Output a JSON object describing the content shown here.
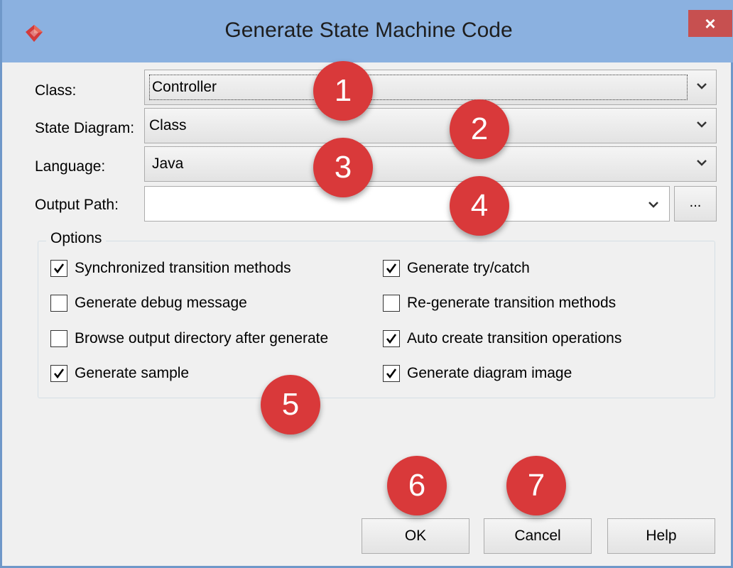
{
  "window": {
    "title": "Generate State Machine Code",
    "close_label": "×"
  },
  "form": {
    "class_label": "Class:",
    "class_value": "Controller",
    "state_diagram_label": "State Diagram:",
    "state_diagram_value": "Class",
    "language_label": "Language:",
    "language_value": "Java",
    "output_path_label": "Output Path:",
    "output_path_value": "",
    "browse_label": "..."
  },
  "options": {
    "title": "Options",
    "items": [
      {
        "label": "Synchronized transition methods",
        "checked": true
      },
      {
        "label": "Generate debug message",
        "checked": false
      },
      {
        "label": "Browse output directory after generate",
        "checked": false
      },
      {
        "label": "Generate sample",
        "checked": true
      },
      {
        "label": "Generate try/catch",
        "checked": true
      },
      {
        "label": "Re-generate transition methods",
        "checked": false
      },
      {
        "label": "Auto create transition operations",
        "checked": true
      },
      {
        "label": "Generate diagram image",
        "checked": true
      }
    ]
  },
  "buttons": {
    "ok": "OK",
    "cancel": "Cancel",
    "help": "Help"
  },
  "callouts": [
    "1",
    "2",
    "3",
    "4",
    "5",
    "6",
    "7"
  ],
  "colors": {
    "titlebar": "#8bb1e0",
    "close": "#c75050",
    "callout": "#d9393a"
  }
}
